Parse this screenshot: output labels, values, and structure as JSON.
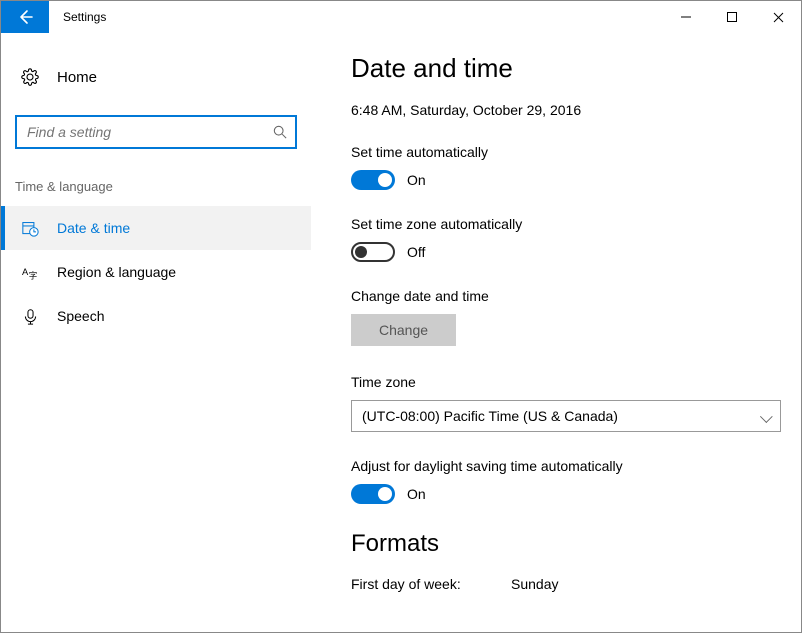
{
  "app": {
    "title": "Settings"
  },
  "sidebar": {
    "home_label": "Home",
    "search_placeholder": "Find a setting",
    "group_label": "Time & language",
    "items": [
      {
        "label": "Date & time"
      },
      {
        "label": "Region & language"
      },
      {
        "label": "Speech"
      }
    ]
  },
  "main": {
    "heading": "Date and time",
    "datetime": "6:48 AM, Saturday, October 29, 2016",
    "set_time_auto": {
      "label": "Set time automatically",
      "state": "On"
    },
    "set_tz_auto": {
      "label": "Set time zone automatically",
      "state": "Off"
    },
    "change_dt": {
      "label": "Change date and time",
      "button": "Change"
    },
    "tz": {
      "label": "Time zone",
      "value": "(UTC-08:00) Pacific Time (US & Canada)"
    },
    "dst": {
      "label": "Adjust for daylight saving time automatically",
      "state": "On"
    },
    "formats": {
      "heading": "Formats",
      "first_day_label": "First day of week:",
      "first_day_value": "Sunday"
    }
  }
}
